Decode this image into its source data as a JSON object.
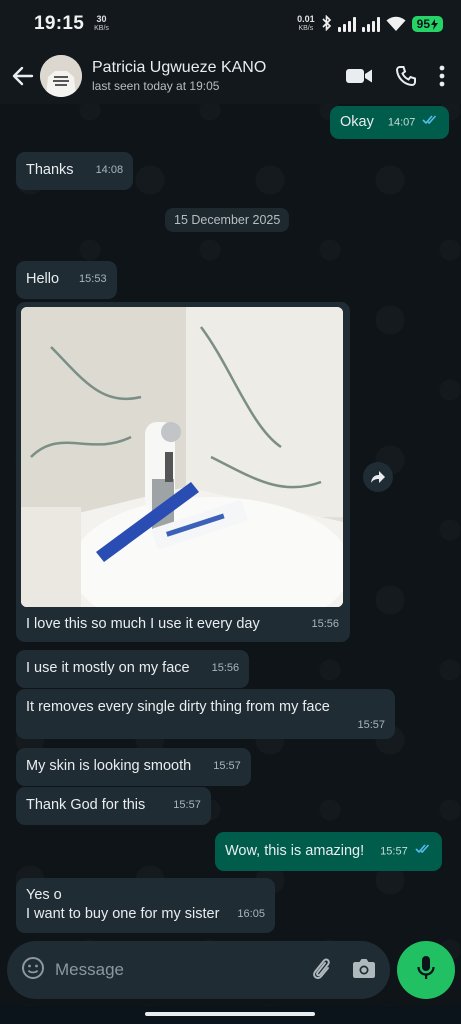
{
  "status_bar": {
    "time": "19:15",
    "net_left": "30",
    "net_left_unit": "KB/s",
    "net_speed": "0.01",
    "net_speed_unit": "KB/s",
    "battery": "95"
  },
  "header": {
    "contact_name": "Patricia Ugwueze KANO",
    "last_seen": "last seen today at 19:05"
  },
  "colors": {
    "outgoing_bubble": "#005c4b",
    "incoming_bubble": "#1f2c34",
    "accent": "#21c063",
    "read_ticks": "#53bdeb"
  },
  "messages": [
    {
      "direction": "out",
      "text": "Okay",
      "time": "14:07",
      "read": true
    },
    {
      "direction": "in",
      "text": "Thanks",
      "time": "14:08"
    },
    {
      "type": "date",
      "text": "15 December 2025"
    },
    {
      "direction": "in",
      "text": "Hello",
      "time": "15:53"
    },
    {
      "direction": "in",
      "type": "image_with_caption",
      "text": "I love this so much I use it every day",
      "time": "15:56"
    },
    {
      "direction": "in",
      "text": "I use it mostly on my face",
      "time": "15:56"
    },
    {
      "direction": "in",
      "text": "It removes every single dirty thing from my face",
      "time": "15:57"
    },
    {
      "direction": "in",
      "text": "My skin is looking smooth",
      "time": "15:57"
    },
    {
      "direction": "in",
      "text": "Thank God for this",
      "time": "15:57"
    },
    {
      "direction": "out",
      "text": "Wow, this is amazing!",
      "time": "15:57",
      "read": true
    },
    {
      "direction": "in",
      "lines": [
        "Yes o",
        "I want to buy one for my sister"
      ],
      "time": "16:05"
    }
  ],
  "input": {
    "placeholder": "Message"
  }
}
